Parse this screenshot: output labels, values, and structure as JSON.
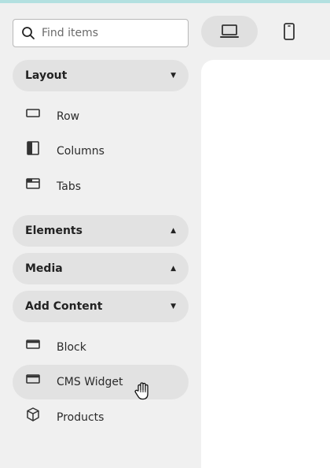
{
  "search": {
    "placeholder": "Find items",
    "icon": "search-icon"
  },
  "device_toggle": [
    {
      "name": "desktop",
      "icon": "laptop-icon",
      "selected": true
    },
    {
      "name": "mobile",
      "icon": "mobile-icon",
      "selected": false
    }
  ],
  "groups": {
    "layout": {
      "title": "Layout",
      "expanded": true,
      "items": [
        {
          "label": "Row",
          "icon": "row-icon"
        },
        {
          "label": "Columns",
          "icon": "columns-icon"
        },
        {
          "label": "Tabs",
          "icon": "tabs-icon"
        }
      ]
    },
    "elements": {
      "title": "Elements",
      "expanded": false
    },
    "media": {
      "title": "Media",
      "expanded": false
    },
    "add_content": {
      "title": "Add Content",
      "expanded": true,
      "items": [
        {
          "label": "Block",
          "icon": "block-icon"
        },
        {
          "label": "CMS Widget",
          "icon": "widget-icon",
          "hovered": true
        },
        {
          "label": "Products",
          "icon": "box-icon"
        }
      ]
    }
  },
  "colors": {
    "panel_bg": "#f0f0f0",
    "pill_bg": "#e2e2e2",
    "canvas_bg": "#ffffff",
    "top_strip": "#b3e0e0"
  }
}
